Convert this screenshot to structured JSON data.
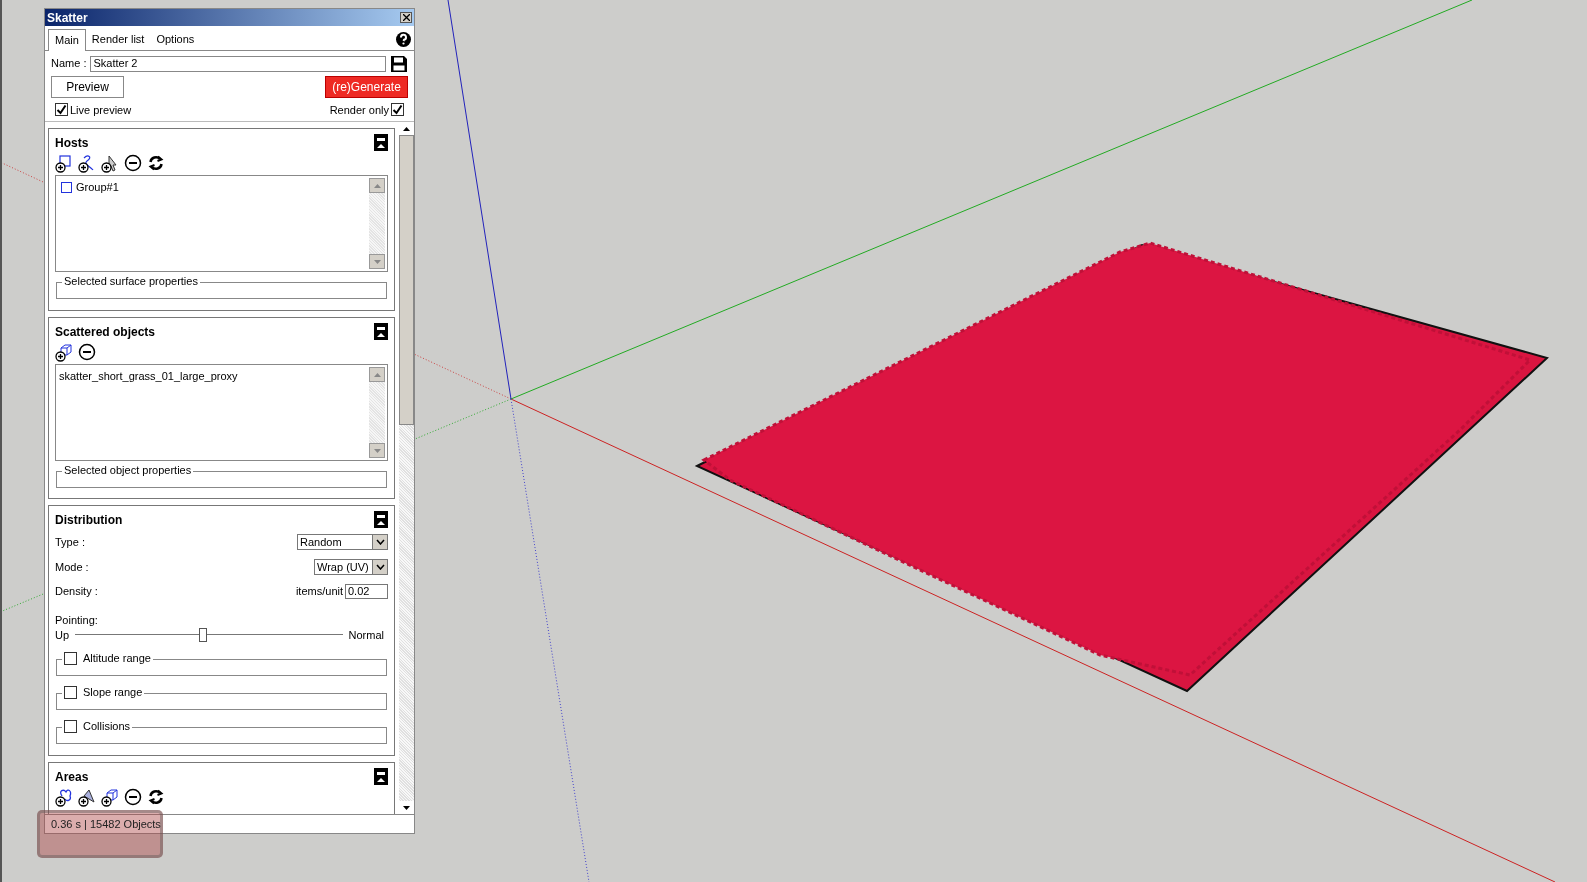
{
  "window": {
    "title": "Skatter"
  },
  "tabs": [
    {
      "label": "Main",
      "selected": true
    },
    {
      "label": "Render list",
      "selected": false
    },
    {
      "label": "Options",
      "selected": false
    }
  ],
  "name_field": {
    "label": "Name :",
    "value": "Skatter 2"
  },
  "preview_button": "Preview",
  "generate_button": "(re)Generate",
  "live_preview": {
    "label": "Live preview",
    "checked": true
  },
  "render_only": {
    "label": "Render only",
    "checked": true
  },
  "hosts": {
    "title": "Hosts",
    "items": [
      {
        "label": "Group#1"
      }
    ],
    "properties_label": "Selected surface properties"
  },
  "scattered_objects": {
    "title": "Scattered objects",
    "items": [
      {
        "label": "skatter_short_grass_01_large_proxy"
      }
    ],
    "properties_label": "Selected object properties"
  },
  "distribution": {
    "title": "Distribution",
    "type": {
      "label": "Type :",
      "value": "Random"
    },
    "mode": {
      "label": "Mode :",
      "value": "Wrap (UV)"
    },
    "density": {
      "label": "Density :",
      "unit": "items/unit",
      "value": "0.02"
    },
    "pointing": {
      "label": "Pointing:",
      "left": "Up",
      "right": "Normal",
      "level": 0.48
    },
    "options": [
      {
        "label": "Altitude range",
        "checked": false
      },
      {
        "label": "Slope range",
        "checked": false
      },
      {
        "label": "Collisions",
        "checked": false
      }
    ]
  },
  "areas": {
    "title": "Areas"
  },
  "status_bar": {
    "text": "0.36 s | 15482 Objects"
  }
}
